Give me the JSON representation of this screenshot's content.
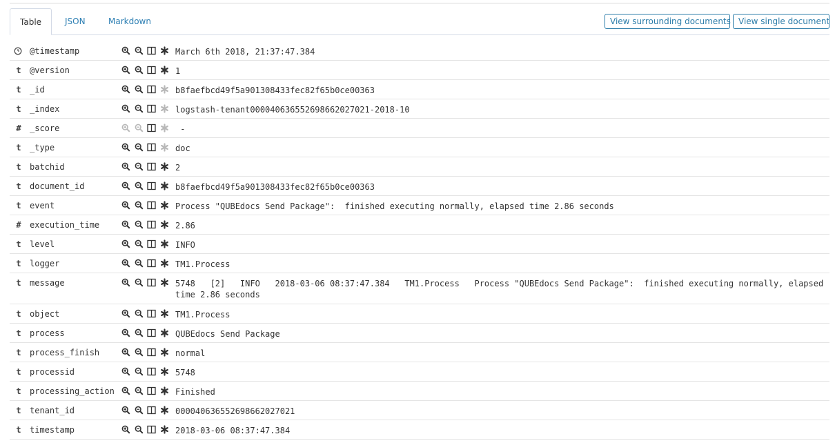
{
  "tabs": [
    "Table",
    "JSON",
    "Markdown"
  ],
  "buttons": {
    "surrounding": "View surrounding documents",
    "single": "View single document"
  },
  "colors": {
    "link": "#2d7fb3",
    "icon": "#333333",
    "icon_disabled": "#b8b8b8",
    "border": "#d3dae6"
  },
  "fields": [
    {
      "type": "clock-icon",
      "name": "@timestamp",
      "value": "March 6th 2018, 21:37:47.384",
      "filter_disabled": false,
      "exists_disabled": false
    },
    {
      "type": "t",
      "name": "@version",
      "value": "1",
      "filter_disabled": false,
      "exists_disabled": false
    },
    {
      "type": "t",
      "name": "_id",
      "value": "b8faefbcd49f5a901308433fec82f65b0ce00363",
      "filter_disabled": false,
      "exists_disabled": true
    },
    {
      "type": "t",
      "name": "_index",
      "value": "logstash-tenant000040636552698662027021-2018-10",
      "filter_disabled": false,
      "exists_disabled": true
    },
    {
      "type": "#",
      "name": "_score",
      "value": " -",
      "filter_disabled": true,
      "exists_disabled": true
    },
    {
      "type": "t",
      "name": "_type",
      "value": "doc",
      "filter_disabled": false,
      "exists_disabled": true
    },
    {
      "type": "t",
      "name": "batchid",
      "value": "2",
      "filter_disabled": false,
      "exists_disabled": false
    },
    {
      "type": "t",
      "name": "document_id",
      "value": "b8faefbcd49f5a901308433fec82f65b0ce00363",
      "filter_disabled": false,
      "exists_disabled": false
    },
    {
      "type": "t",
      "name": "event",
      "value": "Process \"QUBEdocs Send Package\":  finished executing normally, elapsed time 2.86 seconds",
      "filter_disabled": false,
      "exists_disabled": false
    },
    {
      "type": "#",
      "name": "execution_time",
      "value": "2.86",
      "filter_disabled": false,
      "exists_disabled": false
    },
    {
      "type": "t",
      "name": "level",
      "value": "INFO",
      "filter_disabled": false,
      "exists_disabled": false
    },
    {
      "type": "t",
      "name": "logger",
      "value": "TM1.Process",
      "filter_disabled": false,
      "exists_disabled": false
    },
    {
      "type": "t",
      "name": "message",
      "value": "5748   [2]   INFO   2018-03-06 08:37:47.384   TM1.Process   Process \"QUBEdocs Send Package\":  finished executing normally, elapsed time 2.86 seconds",
      "filter_disabled": false,
      "exists_disabled": false,
      "tall": true
    },
    {
      "type": "t",
      "name": "object",
      "value": "TM1.Process",
      "filter_disabled": false,
      "exists_disabled": false
    },
    {
      "type": "t",
      "name": "process",
      "value": "QUBEdocs Send Package",
      "filter_disabled": false,
      "exists_disabled": false
    },
    {
      "type": "t",
      "name": "process_finish",
      "value": "normal",
      "filter_disabled": false,
      "exists_disabled": false
    },
    {
      "type": "t",
      "name": "processid",
      "value": "5748",
      "filter_disabled": false,
      "exists_disabled": false
    },
    {
      "type": "t",
      "name": "processing_action",
      "value": "Finished",
      "filter_disabled": false,
      "exists_disabled": false
    },
    {
      "type": "t",
      "name": "tenant_id",
      "value": "000040636552698662027021",
      "filter_disabled": false,
      "exists_disabled": false
    },
    {
      "type": "t",
      "name": "timestamp",
      "value": "2018-03-06 08:37:47.384",
      "filter_disabled": false,
      "exists_disabled": false
    }
  ]
}
